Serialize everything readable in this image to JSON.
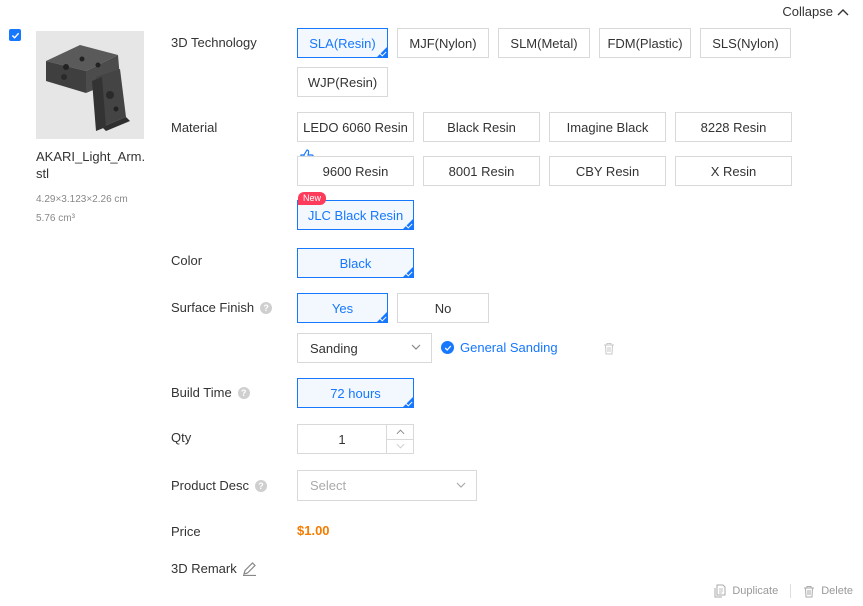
{
  "header": {
    "collapse_label": "Collapse"
  },
  "file": {
    "name": "AKARI_Light_Arm.stl",
    "dimensions": "4.29×3.123×2.26 cm",
    "volume": "5.76 cm³"
  },
  "labels": {
    "technology": "3D Technology",
    "material": "Material",
    "color": "Color",
    "surface_finish": "Surface Finish",
    "build_time": "Build Time",
    "qty": "Qty",
    "product_desc": "Product Desc",
    "price": "Price",
    "remark": "3D Remark"
  },
  "technology": {
    "selected": "SLA(Resin)",
    "options": [
      "SLA(Resin)",
      "MJF(Nylon)",
      "SLM(Metal)",
      "FDM(Plastic)",
      "SLS(Nylon)",
      "WJP(Resin)"
    ]
  },
  "material": {
    "selected": "JLC Black Resin",
    "new_badge": "New",
    "options": [
      "LEDO 6060 Resin",
      "Black Resin",
      "Imagine Black",
      "8228 Resin",
      "9600 Resin",
      "8001 Resin",
      "CBY Resin",
      "X Resin",
      "JLC Black Resin"
    ]
  },
  "color": {
    "options": [
      "Black"
    ],
    "selected": "Black"
  },
  "surface_finish": {
    "options": [
      "Yes",
      "No"
    ],
    "selected": "Yes",
    "finish_select_value": "Sanding",
    "finish_option": "General Sanding"
  },
  "build_time": {
    "options": [
      "72 hours"
    ],
    "selected": "72 hours"
  },
  "qty": {
    "value": "1"
  },
  "product_desc": {
    "placeholder": "Select"
  },
  "price": {
    "value": "$1.00"
  },
  "actions": {
    "duplicate": "Duplicate",
    "delete": "Delete"
  },
  "colors": {
    "accent": "#1677ff",
    "price": "#f57c00",
    "badge": "#ff3b5c"
  }
}
